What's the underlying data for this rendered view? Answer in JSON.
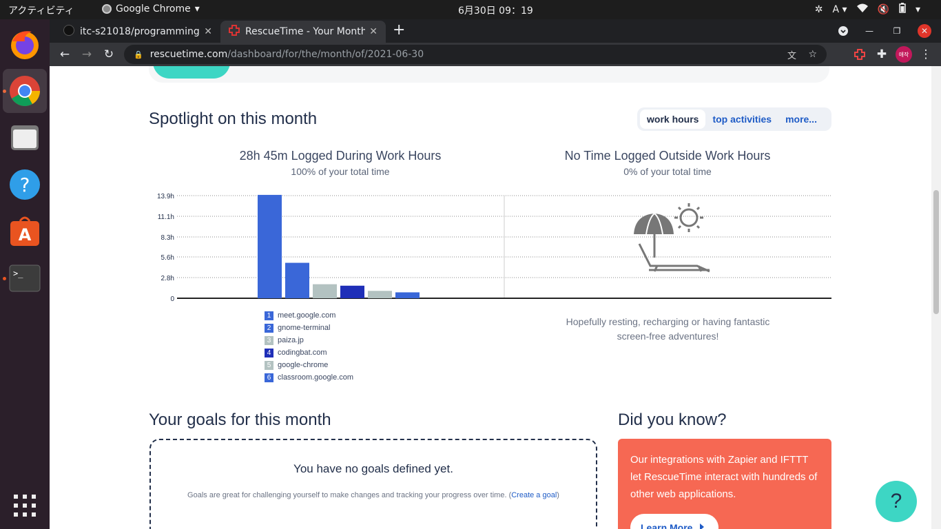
{
  "topbar": {
    "activities": "アクティビティ",
    "app_name": "Google Chrome",
    "clock": "6月30日  09：19",
    "input_method": "A"
  },
  "dock": {
    "items": [
      "firefox-icon",
      "chrome-icon",
      "files-icon",
      "help-icon",
      "software-icon",
      "terminal-icon",
      "app-grid-icon"
    ]
  },
  "browser": {
    "tabs": [
      {
        "title": "itc-s21018/programming"
      },
      {
        "title": "RescueTime - Your Month!"
      }
    ],
    "url_host": "rescuetime.com",
    "url_path": "/dashboard/for/the/month/of/2021-06-30",
    "profile_initial": "애작"
  },
  "spotlight": {
    "heading": "Spotlight on this month",
    "tabs": [
      "work hours",
      "top activities",
      "more..."
    ],
    "work": {
      "title": "28h 45m Logged During Work Hours",
      "subtitle": "100% of your total time"
    },
    "outside": {
      "title": "No Time Logged Outside Work Hours",
      "subtitle": "0% of your total time",
      "message": "Hopefully resting, recharging or having fantastic screen-free adventures!"
    }
  },
  "chart_data": {
    "type": "bar",
    "categories": [
      "meet.google.com",
      "gnome-terminal",
      "paiza.jp",
      "codingbat.com",
      "google-chrome",
      "classroom.google.com"
    ],
    "values": [
      14.0,
      4.8,
      1.9,
      1.7,
      1.0,
      0.8
    ],
    "colors": [
      "#3a67d8",
      "#3a67d8",
      "#b3c2c1",
      "#1f2fb8",
      "#b3c2c1",
      "#3a67d8"
    ],
    "yticks": [
      "0",
      "2.8h",
      "5.6h",
      "8.3h",
      "11.1h",
      "13.9h"
    ],
    "ytick_values": [
      0,
      2.8,
      5.6,
      8.3,
      11.1,
      13.9
    ],
    "ylim": [
      0,
      13.9
    ],
    "legend": [
      {
        "num": "1",
        "label": "meet.google.com",
        "color": "#3a67d8"
      },
      {
        "num": "2",
        "label": "gnome-terminal",
        "color": "#3a67d8"
      },
      {
        "num": "3",
        "label": "paiza.jp",
        "color": "#b3c2c1"
      },
      {
        "num": "4",
        "label": "codingbat.com",
        "color": "#1f2fb8"
      },
      {
        "num": "5",
        "label": "google-chrome",
        "color": "#b3c2c1"
      },
      {
        "num": "6",
        "label": "classroom.google.com",
        "color": "#3a67d8"
      }
    ]
  },
  "goals": {
    "heading": "Your goals for this month",
    "empty": "You have no goals defined yet.",
    "desc": "Goals are great for challenging yourself to make changes and tracking your progress over time. (",
    "link": "Create a goal",
    "desc_end": ")"
  },
  "did_you_know": {
    "heading": "Did you know?",
    "text": "Our integrations with Zapier and IFTTT let RescueTime interact with hundreds of other web applications.",
    "button": "Learn More"
  },
  "help": {
    "label": "?"
  }
}
